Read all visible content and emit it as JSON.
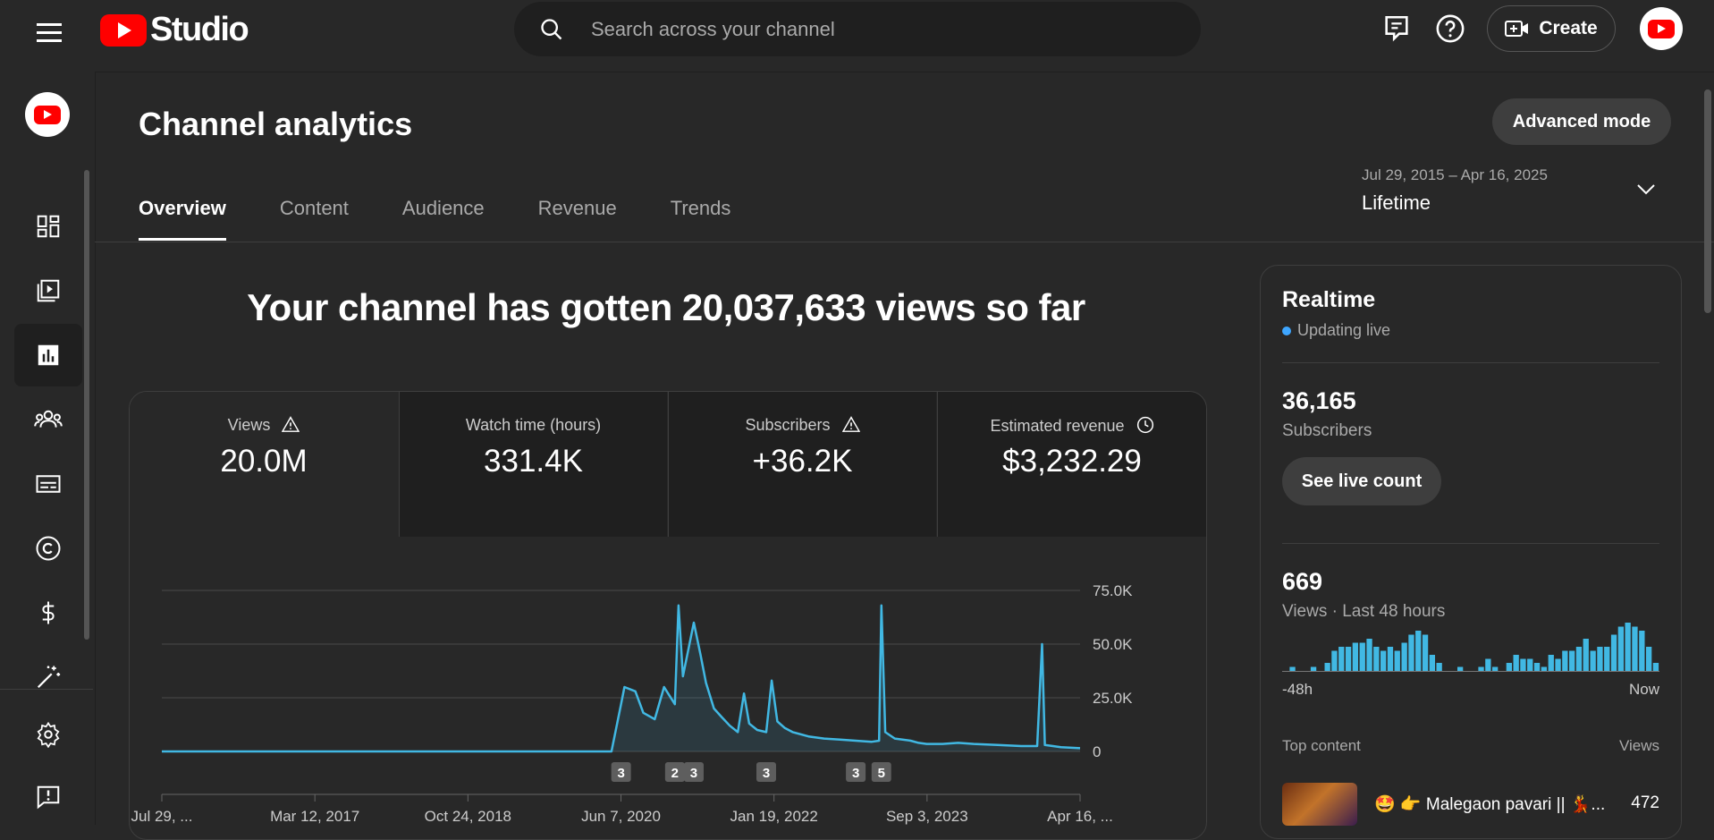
{
  "app": {
    "brand": "Studio"
  },
  "search": {
    "placeholder": "Search across your channel"
  },
  "header": {
    "create_label": "Create"
  },
  "sidebar": {
    "items": [
      {
        "name": "dashboard-icon"
      },
      {
        "name": "content-icon"
      },
      {
        "name": "analytics-icon",
        "active": true
      },
      {
        "name": "community-icon"
      },
      {
        "name": "subtitles-icon"
      },
      {
        "name": "copyright-icon"
      },
      {
        "name": "earn-icon"
      },
      {
        "name": "customization-icon"
      }
    ],
    "bottom": [
      {
        "name": "settings-icon"
      },
      {
        "name": "feedback-icon"
      }
    ]
  },
  "page": {
    "title": "Channel analytics",
    "advanced_mode": "Advanced mode",
    "tabs": [
      "Overview",
      "Content",
      "Audience",
      "Revenue",
      "Trends"
    ],
    "active_tab": "Overview",
    "date_range": {
      "range": "Jul 29, 2015 – Apr 16, 2025",
      "label": "Lifetime"
    },
    "headline": "Your channel has gotten 20,037,633 views so far"
  },
  "metrics": [
    {
      "label": "Views",
      "value": "20.0M",
      "icon": "warning-icon"
    },
    {
      "label": "Watch time (hours)",
      "value": "331.4K",
      "icon": ""
    },
    {
      "label": "Subscribers",
      "value": "+36.2K",
      "icon": "warning-icon"
    },
    {
      "label": "Estimated revenue",
      "value": "$3,232.29",
      "icon": "clock-icon"
    }
  ],
  "colors": {
    "accent": "#3ea6ff",
    "series": "#41b8e3",
    "brand_red": "#ff0000"
  },
  "chart_data": {
    "type": "area",
    "series": [
      {
        "x": [
          "2015-07-29",
          "2016-06-01",
          "2017-06-01",
          "2018-06-01",
          "2019-06-01",
          "2020-05-01",
          "2020-06-07",
          "2020-06-20",
          "2020-08-01",
          "2020-09-01",
          "2020-10-15",
          "2020-11-20",
          "2021-01-01",
          "2021-01-15",
          "2021-02-01",
          "2021-03-15",
          "2021-04-10",
          "2021-05-01",
          "2021-06-01",
          "2021-07-01",
          "2021-08-01",
          "2021-09-01",
          "2021-09-25",
          "2021-10-15",
          "2021-11-15",
          "2021-12-20",
          "2022-01-10",
          "2022-02-01",
          "2022-03-01",
          "2022-04-01",
          "2022-06-01",
          "2022-08-01",
          "2022-10-01",
          "2022-12-01",
          "2023-02-01",
          "2023-03-01",
          "2023-03-10",
          "2023-03-25",
          "2023-05-01",
          "2023-07-01",
          "2023-08-01",
          "2023-09-01",
          "2023-11-01",
          "2024-01-01",
          "2024-03-01",
          "2024-06-01",
          "2024-09-01",
          "2024-11-01",
          "2024-11-20",
          "2024-12-01",
          "2025-02-01",
          "2025-04-16"
        ],
        "y": [
          0,
          0,
          0,
          0,
          0,
          0,
          22000,
          30000,
          28000,
          18000,
          15000,
          30000,
          22000,
          68000,
          35000,
          60000,
          45000,
          32000,
          20000,
          16000,
          12000,
          9000,
          27000,
          13000,
          10000,
          9000,
          33000,
          14000,
          11000,
          9000,
          7000,
          6000,
          5500,
          5000,
          4500,
          5000,
          68000,
          9000,
          6000,
          5000,
          4000,
          3500,
          3500,
          4000,
          3500,
          3000,
          2500,
          2500,
          50000,
          3000,
          2000,
          1500
        ]
      }
    ],
    "yticks": [
      "75.0K",
      "50.0K",
      "25.0K",
      "0"
    ],
    "ylim": [
      0,
      75000
    ],
    "xticks": [
      "Jul 29, ...",
      "Mar 12, 2017",
      "Oct 24, 2018",
      "Jun 7, 2020",
      "Jan 19, 2022",
      "Sep 3, 2023",
      "Apr 16, ..."
    ],
    "annotations": [
      {
        "x": "2020-06-07",
        "label": "3"
      },
      {
        "x": "2021-01-01",
        "label": "2"
      },
      {
        "x": "2021-03-15",
        "label": "3"
      },
      {
        "x": "2021-12-20",
        "label": "3"
      },
      {
        "x": "2022-12-01",
        "label": "3"
      },
      {
        "x": "2023-03-10",
        "label": "5"
      }
    ],
    "grid": true
  },
  "realtime": {
    "title": "Realtime",
    "status": "Updating live",
    "subscribers_value": "36,165",
    "subscribers_label": "Subscribers",
    "live_count_button": "See live count",
    "views_value": "669",
    "views_label": "Views · Last 48 hours",
    "axis_start": "-48h",
    "axis_end": "Now",
    "hourly_views": [
      0,
      1,
      0,
      0,
      1,
      0,
      2,
      5,
      6,
      6,
      7,
      7,
      8,
      6,
      5,
      6,
      5,
      7,
      9,
      10,
      9,
      4,
      2,
      0,
      0,
      1,
      0,
      0,
      1,
      3,
      1,
      0,
      2,
      4,
      3,
      3,
      2,
      1,
      4,
      3,
      5,
      5,
      6,
      8,
      5,
      6,
      6,
      9,
      11,
      12,
      11,
      10,
      6,
      2
    ],
    "top_content_label": "Top content",
    "top_content_views_label": "Views",
    "top_content": [
      {
        "title": "🤩 👉 Malegaon pavari || 💃...",
        "views": "472"
      }
    ]
  }
}
